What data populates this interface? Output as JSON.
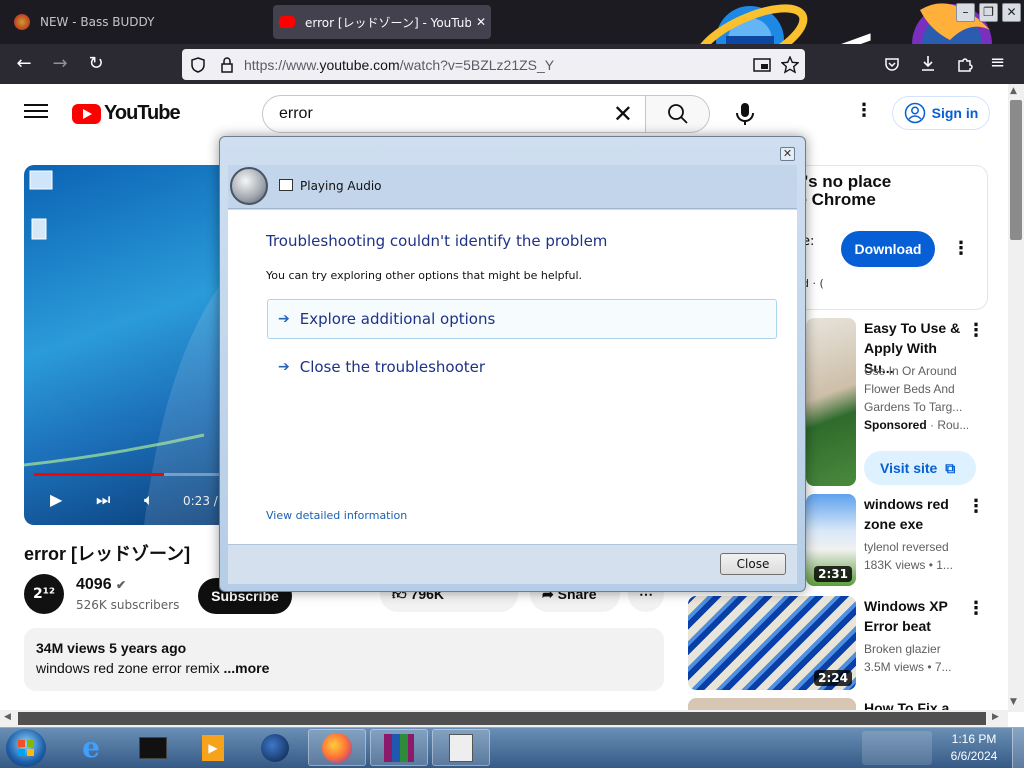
{
  "browser": {
    "tabs": [
      {
        "title": "NEW - Bass BUDDY",
        "active": false
      },
      {
        "title": "error [レッドゾーン] - YouTube",
        "active": true
      }
    ],
    "url_prefix": "https://www.",
    "url_domain": "youtube.com",
    "url_rest": "/watch?v=5BZLz21ZS_Y",
    "overlay_glyph": "<"
  },
  "youtube": {
    "logo": "YouTube",
    "search_value": "error",
    "signin": "Sign in",
    "video": {
      "title": "error [レッドゾーン]",
      "time": "0:23 /",
      "progress": 0.7
    },
    "channel": {
      "avatar": "2¹²",
      "name": "4096",
      "subs": "526K subscribers",
      "subscribe": "Subscribe"
    },
    "actions": {
      "likes": "796K",
      "share": "Share"
    },
    "description": {
      "stats": "34M views  5 years ago",
      "text": "windows red zone error remix",
      "more": "...more"
    },
    "ad": {
      "headline_line1": "re's no place",
      "headline_line2": "ke Chrome",
      "frag1": "e:",
      "frag2": "-",
      "frag3": "d · (",
      "download": "Download"
    },
    "recommendations": [
      {
        "title": "Easy To Use & Apply With Su...",
        "meta1": "Use In Or Around",
        "meta2": "Flower Beds And",
        "meta3": "Gardens To Targ...",
        "sponsored": "Sponsored",
        "sponsor_rest": " · Rou...",
        "visit": "Visit site"
      },
      {
        "title": "windows red zone exe",
        "meta1": "tylenol reversed",
        "meta2": "183K views  • 1...",
        "duration": "2:31"
      },
      {
        "title": "Windows XP Error beat",
        "meta1": "Broken glazier",
        "meta2": "3.5M views  • 7...",
        "duration": "2:24"
      },
      {
        "title": "How To Fix a"
      }
    ]
  },
  "dialog": {
    "title": "Playing Audio",
    "heading": "Troubleshooting couldn't identify the problem",
    "subtext": "You can try exploring other options that might be helpful.",
    "options": [
      "Explore additional options",
      "Close the troubleshooter"
    ],
    "link": "View detailed information",
    "close": "Close"
  },
  "taskbar": {
    "time": "1:16 PM",
    "date": "6/6/2024"
  }
}
